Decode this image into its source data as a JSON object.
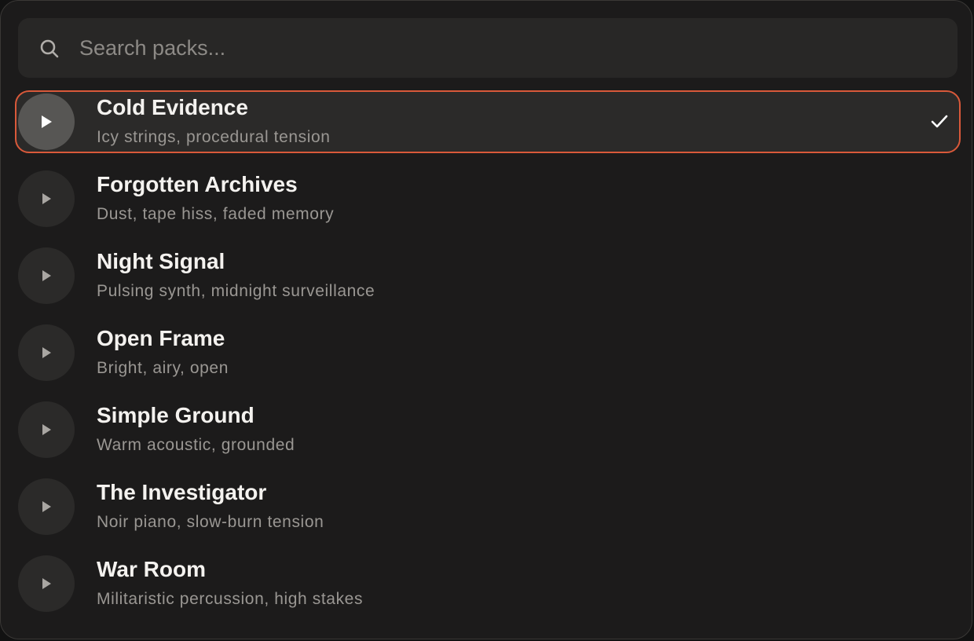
{
  "search": {
    "placeholder": "Search packs...",
    "value": ""
  },
  "packs": [
    {
      "title": "Cold Evidence",
      "subtitle": "Icy strings, procedural tension",
      "selected": true
    },
    {
      "title": "Forgotten Archives",
      "subtitle": "Dust, tape hiss, faded memory",
      "selected": false
    },
    {
      "title": "Night Signal",
      "subtitle": "Pulsing synth, midnight surveillance",
      "selected": false
    },
    {
      "title": "Open Frame",
      "subtitle": "Bright, airy, open",
      "selected": false
    },
    {
      "title": "Simple Ground",
      "subtitle": "Warm acoustic, grounded",
      "selected": false
    },
    {
      "title": "The Investigator",
      "subtitle": "Noir piano, slow-burn tension",
      "selected": false
    },
    {
      "title": "War Room",
      "subtitle": "Militaristic percussion, high stakes",
      "selected": false
    }
  ],
  "icons": {
    "search": "search-icon",
    "play": "play-icon",
    "selected": "check-icon"
  },
  "colors": {
    "accent": "#d9593a",
    "panel": "#1c1b1b",
    "text": "#f4f2ef",
    "muted": "#9a9793"
  }
}
